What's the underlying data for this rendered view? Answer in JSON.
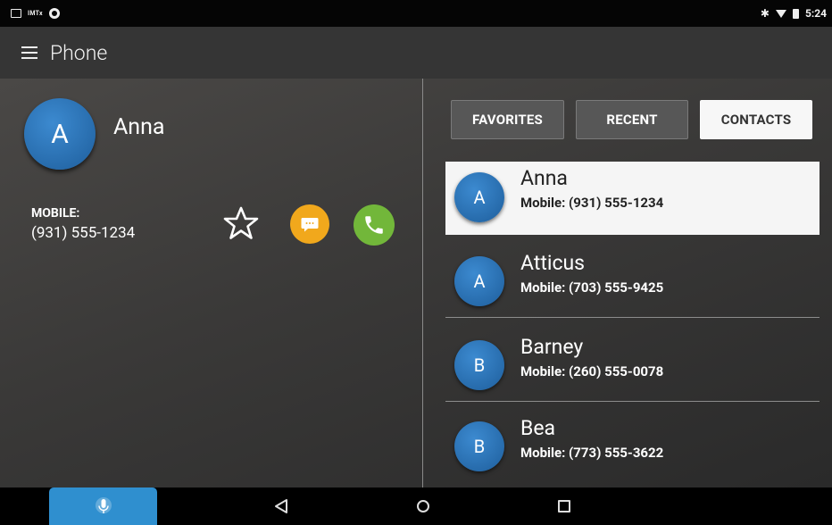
{
  "status_bar": {
    "time": "5:24",
    "notification_text": "IMTx",
    "bluetooth_glyph": "✱"
  },
  "app_bar": {
    "title": "Phone"
  },
  "detail": {
    "avatar_letter": "A",
    "name": "Anna",
    "phone_type_label": "MOBILE:",
    "phone_number": "(931) 555-1234"
  },
  "tabs": [
    {
      "label": "FAVORITES",
      "active": false
    },
    {
      "label": "RECENT",
      "active": false
    },
    {
      "label": "CONTACTS",
      "active": true
    }
  ],
  "contacts": [
    {
      "initial": "A",
      "name": "Anna",
      "phone": "Mobile:  (931) 555-1234",
      "selected": true
    },
    {
      "initial": "A",
      "name": "Atticus",
      "phone": "Mobile:  (703) 555-9425",
      "selected": false
    },
    {
      "initial": "B",
      "name": "Barney",
      "phone": "Mobile:  (260) 555-0078",
      "selected": false
    },
    {
      "initial": "B",
      "name": "Bea",
      "phone": "Mobile:  (773) 555-3622",
      "selected": false
    }
  ],
  "colors": {
    "avatar_blue": "#2a74b8",
    "message_orange": "#f1a81c",
    "call_green": "#72b73a",
    "mic_blue": "#2f8fcf"
  },
  "icons": {
    "menu": "menu-icon",
    "favorite": "star-outline-icon",
    "message": "message-icon",
    "call": "phone-icon",
    "mic": "microphone-icon",
    "back": "back-triangle-icon",
    "home": "home-circle-icon",
    "recents": "recents-square-icon"
  }
}
